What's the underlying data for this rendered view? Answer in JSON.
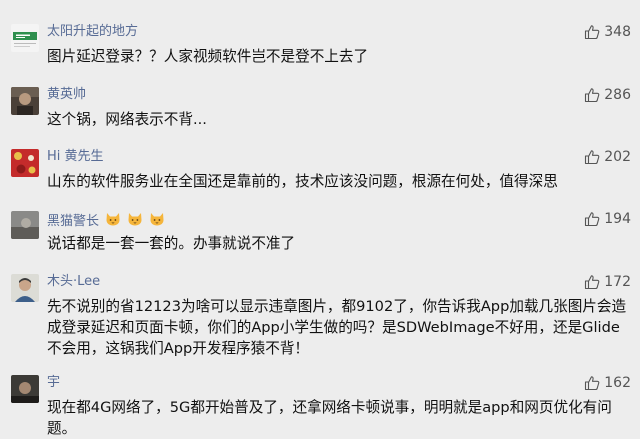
{
  "comments": [
    {
      "user": "太阳升起的地方",
      "likes": "348",
      "text": "图片延迟登录？？人家视频软件岂不是登不上去了",
      "avatar": "green-sign"
    },
    {
      "user": "黄英帅",
      "likes": "286",
      "text": "这个锅，网络表示不背...",
      "avatar": "dark-photo"
    },
    {
      "user": "Hi 黄先生",
      "likes": "202",
      "text": "山东的软件服务业在全国还是靠前的，技术应该没问题，根源在何处，值得深思",
      "avatar": "red-pattern"
    },
    {
      "user": "黑猫警长",
      "likes": "194",
      "text": "说话都是一套一套的。办事就说不准了",
      "avatar": "gray-photo",
      "emojis": [
        "cat-face",
        "cat-face",
        "cat-face"
      ]
    },
    {
      "user": "木头·Lee",
      "likes": "172",
      "text": "先不说别的省12123为啥可以显示违章图片，都9102了，你告诉我App加载几张图片会造成登录延迟和页面卡顿，你们的App小学生做的吗？是SDWebImage不好用，还是Glide不会用，这锅我们App开发程序猿不背！",
      "avatar": "person-photo"
    },
    {
      "user": "宇",
      "likes": "162",
      "text": "现在都4G网络了，5G都开始普及了，还拿网络卡顿说事，明明就是app和网页优化有问题。",
      "avatar": "dark-photo-2"
    }
  ],
  "icons": {
    "like": "thumbs-up-icon"
  },
  "colors": {
    "background": "#ededed",
    "username": "#576b95",
    "text": "#111111",
    "count": "#555555"
  }
}
